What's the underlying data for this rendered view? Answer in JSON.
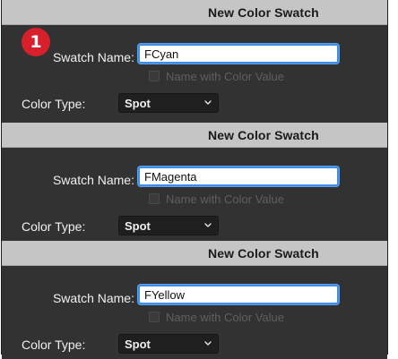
{
  "step_badge": "1",
  "panels": [
    {
      "title": "New Color Swatch",
      "swatch_name_label": "Swatch Name:",
      "swatch_name_value": "FCyan",
      "name_with_color_value_label": "Name with Color Value",
      "name_with_color_value_checked": false,
      "color_type_label": "Color Type:",
      "color_type_value": "Spot"
    },
    {
      "title": "New Color Swatch",
      "swatch_name_label": "Swatch Name:",
      "swatch_name_value": "FMagenta",
      "name_with_color_value_label": "Name with Color Value",
      "name_with_color_value_checked": false,
      "color_type_label": "Color Type:",
      "color_type_value": "Spot"
    },
    {
      "title": "New Color Swatch",
      "swatch_name_label": "Swatch Name:",
      "swatch_name_value": "FYellow",
      "name_with_color_value_label": "Name with Color Value",
      "name_with_color_value_checked": false,
      "color_type_label": "Color Type:",
      "color_type_value": "Spot"
    }
  ],
  "colors": {
    "accent_focus": "#3d8ee8",
    "badge": "#d7202b",
    "panel_bg": "#323232",
    "titlebar_bg": "#c5c5c5"
  },
  "icons": {
    "dropdown": "chevron-down-icon",
    "checkbox": "checkbox-icon"
  }
}
